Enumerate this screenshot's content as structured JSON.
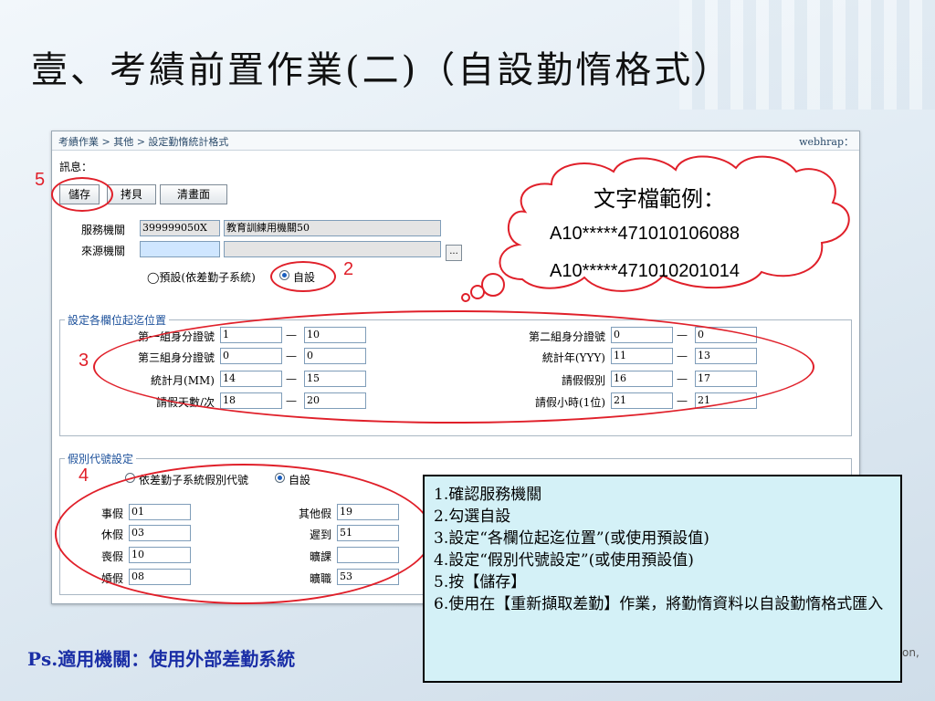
{
  "slide": {
    "title": "壹、考績前置作業(二)（自設勤惰格式）",
    "footnote": "Ps.適用機關：使用外部差勤系統",
    "corner_text": "on,"
  },
  "app": {
    "breadcrumb": "考績作業 > 其他 > 設定勤惰統計格式",
    "user": "webhrap：",
    "message_label": "訊息：",
    "buttons": {
      "save": "儲存",
      "copy": "拷貝",
      "clear": "清畫面"
    },
    "service_org": {
      "label": "服務機關",
      "code": "399999050X",
      "name": "教育訓練用機關50"
    },
    "source_org": {
      "label": "來源機關",
      "code": "",
      "name": "",
      "lookup": "..."
    },
    "format_options": {
      "default": "◯預設(依差勤子系統)",
      "custom": "自設",
      "selected": "custom"
    },
    "positions": {
      "legend": "設定各欄位起迄位置",
      "left": [
        {
          "label": "第一組身分證號",
          "from": "1",
          "to": "10"
        },
        {
          "label": "第三組身分證號",
          "from": "0",
          "to": "0"
        },
        {
          "label": "統計月(MM)",
          "from": "14",
          "to": "15"
        },
        {
          "label": "請假天數/次",
          "from": "18",
          "to": "20"
        }
      ],
      "right": [
        {
          "label": "第二組身分證號",
          "from": "0",
          "to": "0"
        },
        {
          "label": "統計年(YYY)",
          "from": "11",
          "to": "13"
        },
        {
          "label": "請假假別",
          "from": "16",
          "to": "17"
        },
        {
          "label": "請假小時(1位)",
          "from": "21",
          "to": "21"
        }
      ],
      "dash": "—"
    },
    "leave_codes": {
      "legend": "假別代號設定",
      "options": {
        "by_system": "依差勤子系統假別代號",
        "custom": "自設",
        "selected": "custom"
      },
      "left": [
        {
          "label": "事假",
          "value": "01"
        },
        {
          "label": "休假",
          "value": "03"
        },
        {
          "label": "喪假",
          "value": "10"
        },
        {
          "label": "婚假",
          "value": "08"
        }
      ],
      "right": [
        {
          "label": "其他假",
          "value": "19"
        },
        {
          "label": "遲到",
          "value": "51"
        },
        {
          "label": "曠課",
          "value": ""
        },
        {
          "label": "曠職",
          "value": "53"
        }
      ]
    }
  },
  "annotations": {
    "numbers": [
      "5",
      "2",
      "3",
      "4"
    ],
    "cloud": {
      "title": "文字檔範例：",
      "line1": "A10*****471010106088",
      "line2": "A10*****471010201014"
    }
  },
  "instructions": [
    "1.確認服務機關",
    "2.勾選自設",
    "3.設定“各欄位起迄位置”(或使用預設值)",
    "4.設定“假別代號設定”(或使用預設值)",
    "5.按【儲存】",
    "6.使用在【重新擷取差勤】作業，將勤惰資料以自設勤惰格式匯入"
  ],
  "colors": {
    "annotation_red": "#e0202a",
    "legend_blue": "#1a4f9a",
    "instruction_bg": "#d4f1f7",
    "footnote_blue": "#1a2ea6"
  }
}
